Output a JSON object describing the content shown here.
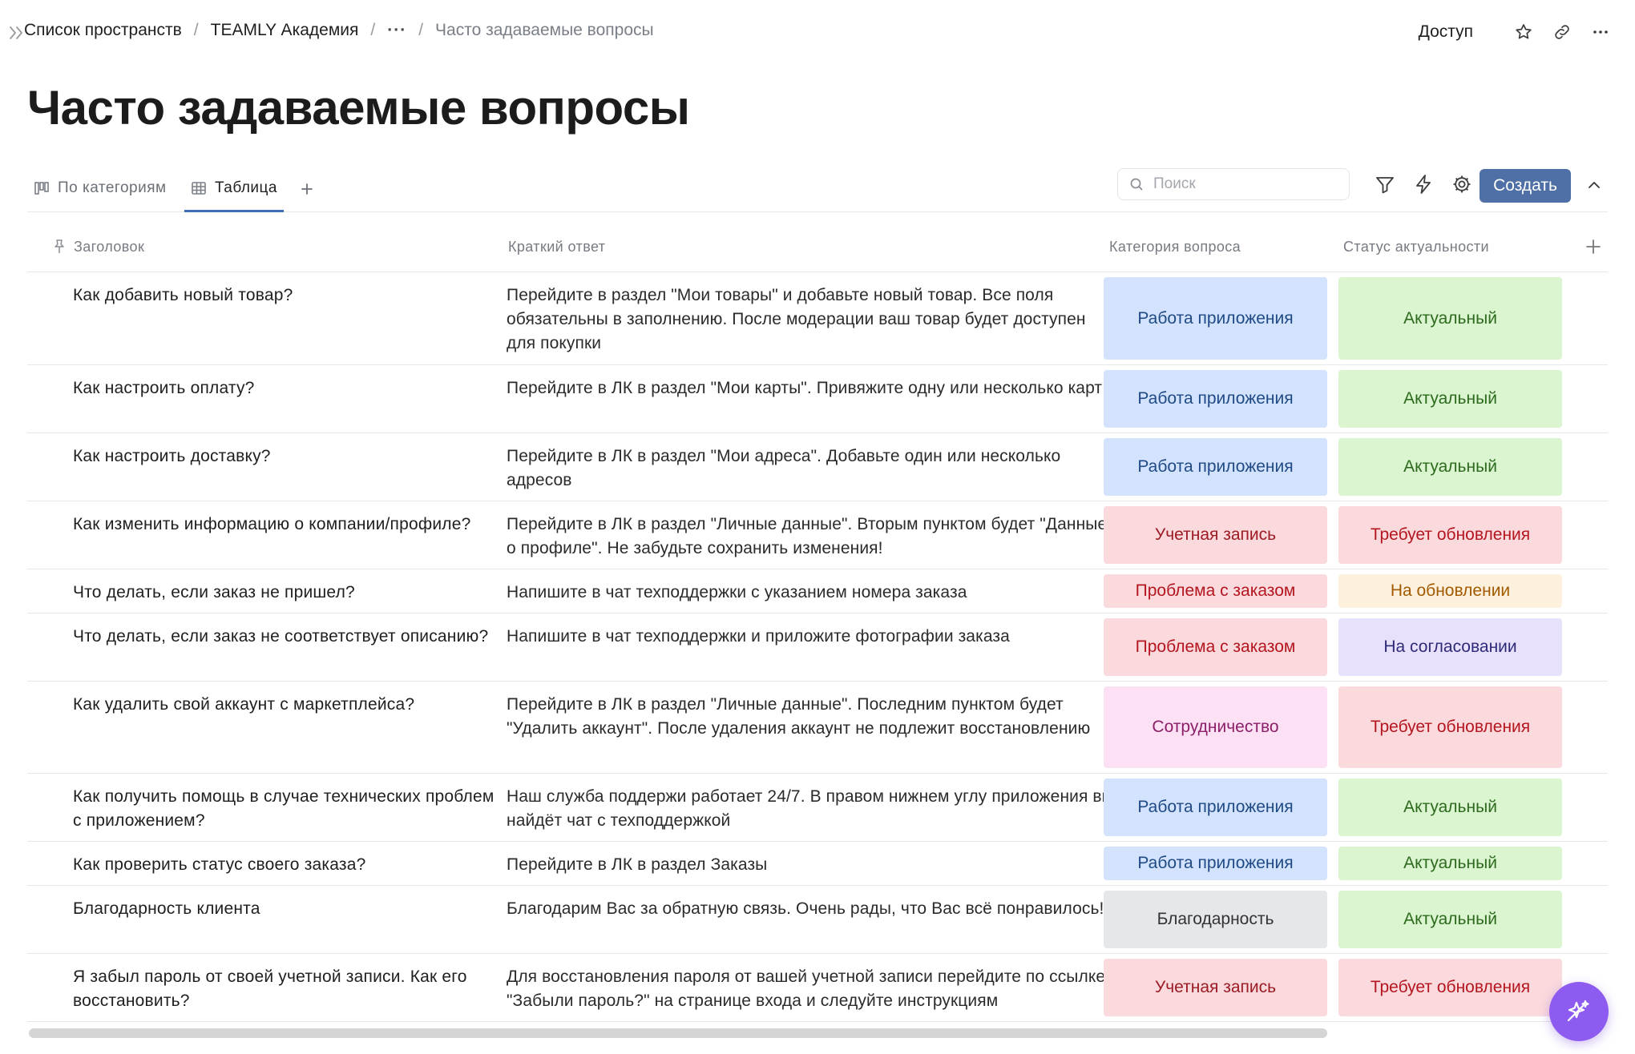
{
  "breadcrumb": {
    "items": [
      "Список пространств",
      "TEAMLY Академия"
    ],
    "more": "···",
    "separator": "/",
    "current": "Часто задаваемые вопросы"
  },
  "header": {
    "access_label": "Доступ",
    "icons": [
      "star-icon",
      "link-icon",
      "more-icon"
    ]
  },
  "page": {
    "title": "Часто задаваемые вопросы"
  },
  "views": {
    "tabs": [
      {
        "label": "По категориям",
        "icon": "kanban-icon",
        "active": false
      },
      {
        "label": "Таблица",
        "icon": "table-icon",
        "active": true
      }
    ]
  },
  "toolbar": {
    "search_placeholder": "Поиск",
    "create_label": "Создать",
    "icons": [
      "filter-icon",
      "automation-icon",
      "settings-icon",
      "collapse-icon"
    ]
  },
  "table": {
    "columns": [
      "Заголовок",
      "Краткий ответ",
      "Категория вопроса",
      "Статус актуальности"
    ],
    "rows": [
      {
        "title": "Как добавить новый товар?",
        "answer": "Перейдите в раздел \"Мои товары\" и добавьте новый товар. Все поля обязательны в заполнению. После модерации ваш товар будет доступен для покупки",
        "category": "Работа приложения",
        "status": "Актуальный"
      },
      {
        "title": "Как настроить оплату?",
        "answer": "Перейдите в ЛК в раздел \"Мои карты\". Привяжите одну или несколько карт",
        "category": "Работа приложения",
        "status": "Актуальный"
      },
      {
        "title": "Как настроить доставку?",
        "answer": "Перейдите в ЛК в раздел \"Мои адреса\". Добавьте один или несколько адресов",
        "category": "Работа приложения",
        "status": "Актуальный"
      },
      {
        "title": "Как изменить информацию о компании/профиле?",
        "answer": "Перейдите в ЛК в раздел \"Личные данные\". Вторым пунктом будет \"Данные о профиле\". Не забудьте сохранить изменения!",
        "category": "Учетная запись",
        "status": "Требует обновления"
      },
      {
        "title": "Что делать, если заказ не пришел?",
        "answer": "Напишите в чат техподдержки с указанием номера заказа",
        "category": "Проблема с заказом",
        "status": "На обновлении"
      },
      {
        "title": "Что делать, если заказ не соответствует описанию?",
        "answer": "Напишите в чат техподдержки и приложите фотографии заказа",
        "category": "Проблема с заказом",
        "status": "На согласовании"
      },
      {
        "title": "Как удалить свой аккаунт с маркетплейса?",
        "answer": "Перейдите в ЛК в раздел \"Личные данные\". Последним пунктом будет \"Удалить аккаунт\". После удаления аккаунт не подлежит восстановлению",
        "category": "Сотрудничество",
        "status": "Требует обновления"
      },
      {
        "title": "Как получить помощь в случае технических проблем с приложением?",
        "answer": "Наш служба поддержи работает 24/7. В правом нижнем углу приложения вы найдёт чат с техподдержкой",
        "category": "Работа приложения",
        "status": "Актуальный"
      },
      {
        "title": "Как проверить статус своего заказа?",
        "answer": "Перейдите в ЛК в раздел Заказы",
        "category": "Работа приложения",
        "status": "Актуальный"
      },
      {
        "title": "Благодарность клиента",
        "answer": "Благодарим Вас за обратную связь. Очень рады, что Вас всё понравилось!",
        "category": "Благодарность",
        "status": "Актуальный"
      },
      {
        "title": "Я забыл пароль от своей учетной записи. Как его восстановить?",
        "answer": "Для восстановления пароля от вашей учетной записи перейдите по ссылке \"Забыли пароль?\" на странице входа и следуйте инструкциям",
        "category": "Учетная запись",
        "status": "Требует обновления"
      }
    ]
  },
  "tag_colors": {
    "Работа приложения": {
      "bg": "#d3e3fd",
      "fg": "#1f4a85"
    },
    "Учетная запись": {
      "bg": "#fadadd",
      "fg": "#9c1b24"
    },
    "Проблема с заказом": {
      "bg": "#fadadd",
      "fg": "#b4151f"
    },
    "Сотрудничество": {
      "bg": "#fbe1f3",
      "fg": "#8b1f6a"
    },
    "Благодарность": {
      "bg": "#e6e7ea",
      "fg": "#333333"
    },
    "Актуальный": {
      "bg": "#daf5cf",
      "fg": "#2d6a1e"
    },
    "Требует обновления": {
      "bg": "#fadadd",
      "fg": "#b4151f"
    },
    "На обновлении": {
      "bg": "#fdf1de",
      "fg": "#a25a00"
    },
    "На согласовании": {
      "bg": "#e7e1fb",
      "fg": "#2e2a78"
    }
  },
  "accent": "#4f70a6",
  "ai_assistant_icon": "sparkles-icon"
}
